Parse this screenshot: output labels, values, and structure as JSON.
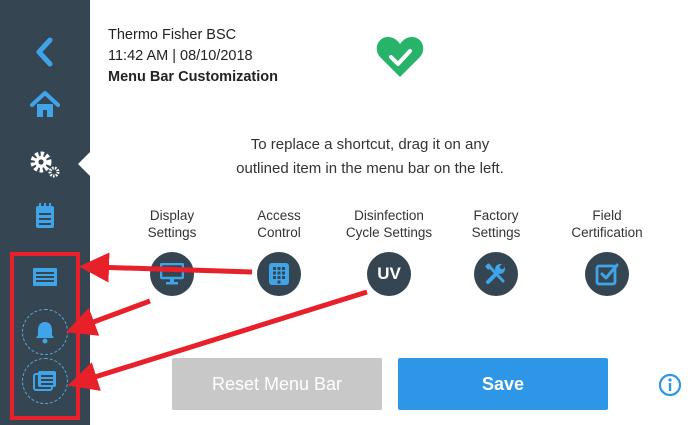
{
  "header": {
    "device_name": "Thermo Fisher BSC",
    "datetime": "11:42  AM | 08/10/2018",
    "page_title": "Menu Bar Customization"
  },
  "sidebar": {
    "items": [
      {
        "icon": "back-chevron-icon"
      },
      {
        "icon": "home-icon"
      },
      {
        "icon": "gear-settings-icon",
        "active": true
      },
      {
        "icon": "clipboard-icon"
      },
      {
        "icon": "display-monitor-icon"
      },
      {
        "icon": "bell-icon"
      },
      {
        "icon": "folder-list-icon"
      }
    ]
  },
  "instruction": {
    "line1": "To replace a shortcut, drag it on any",
    "line2": "outlined item in the menu bar on the left."
  },
  "shortcuts": [
    {
      "line1": "Display",
      "line2": "Settings",
      "icon": "monitor-icon"
    },
    {
      "line1": "Access",
      "line2": "Control",
      "icon": "keypad-icon"
    },
    {
      "line1": "Disinfection",
      "line2": "Cycle Settings",
      "icon": "uv-icon",
      "icon_text": "UV"
    },
    {
      "line1": "Factory",
      "line2": "Settings",
      "icon": "wrench-screwdriver-icon"
    },
    {
      "line1": "Field",
      "line2": "Certification",
      "icon": "checkbox-icon"
    }
  ],
  "buttons": {
    "reset_label": "Reset Menu Bar",
    "save_label": "Save"
  },
  "colors": {
    "sidebar": "#354551",
    "accent": "#2e96e6",
    "status_green": "#27b36a",
    "annotation_red": "#e8202a",
    "disabled": "#c8c8c8"
  }
}
